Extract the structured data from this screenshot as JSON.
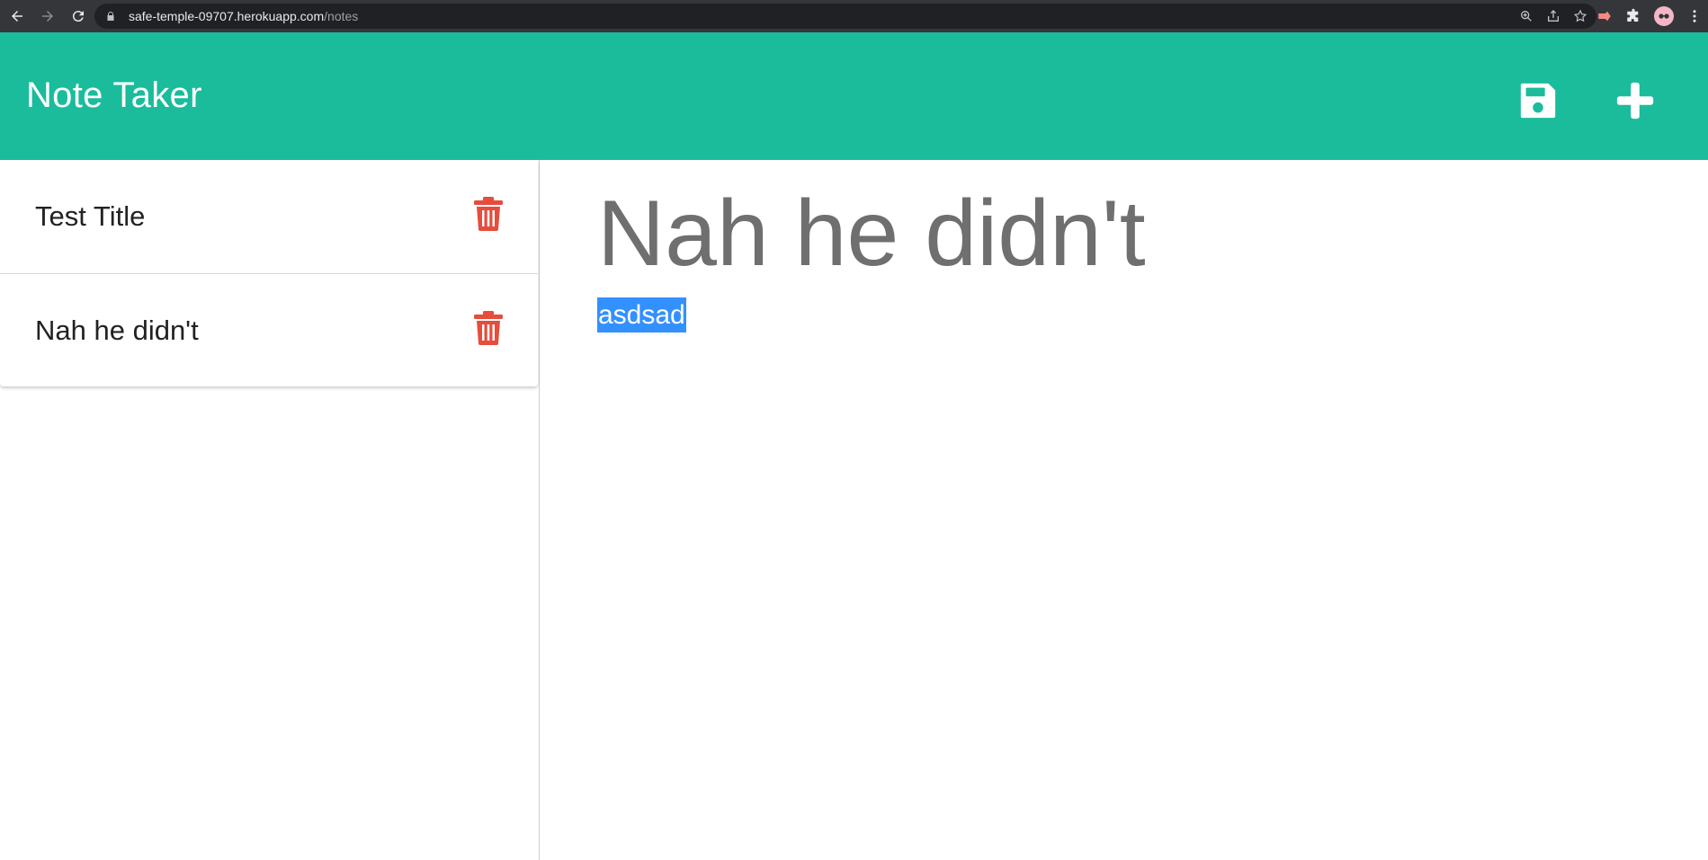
{
  "browser": {
    "url_host": "safe-temple-09707.herokuapp.com",
    "url_path": "/notes"
  },
  "header": {
    "title": "Note Taker",
    "save_icon": "floppy-disk-icon",
    "new_icon": "plus-icon"
  },
  "sidebar": {
    "notes": [
      {
        "title": "Test Title",
        "delete_icon": "trash-icon"
      },
      {
        "title": "Nah he didn't",
        "delete_icon": "trash-icon"
      }
    ]
  },
  "editor": {
    "title_value": "Nah he didn't",
    "body_value": "asdsad"
  },
  "colors": {
    "header_bg": "#1abc9c",
    "delete_red": "#e74c3c",
    "selection": "#3390ff"
  }
}
